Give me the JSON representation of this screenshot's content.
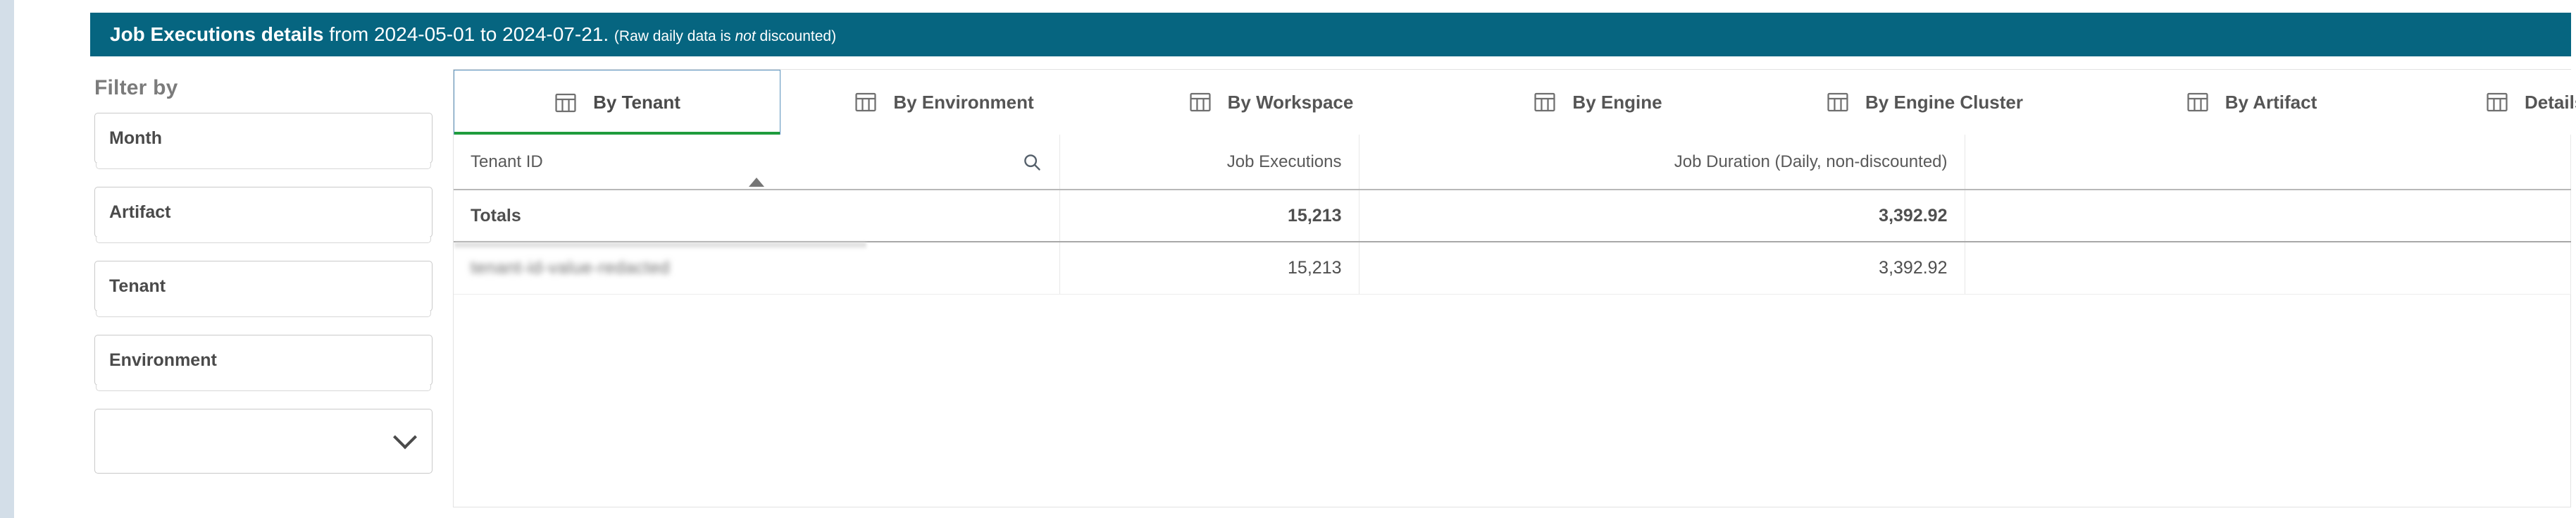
{
  "banner": {
    "title_strong": "Job Executions details",
    "title_range": " from 2024-05-01 to 2024-07-21. ",
    "note_open": "(Raw daily data is ",
    "note_italic": "not",
    "note_close": " discounted)",
    "bg_color": "#066580",
    "text_color": "#ffffff"
  },
  "sidebar": {
    "heading": "Filter by",
    "filters": [
      {
        "label": "Month"
      },
      {
        "label": "Artifact"
      },
      {
        "label": "Tenant"
      },
      {
        "label": "Environment"
      }
    ],
    "dropdown": {
      "value": "",
      "placeholder": "",
      "icon": "chevron-down-icon"
    }
  },
  "tabs": {
    "active_index": 0,
    "active_border_color": "#5b93bd",
    "active_underline_color": "#1f9c3d",
    "items": [
      {
        "label": "By Tenant",
        "icon": "table-icon"
      },
      {
        "label": "By Environment",
        "icon": "table-icon"
      },
      {
        "label": "By Workspace",
        "icon": "table-icon"
      },
      {
        "label": "By Engine",
        "icon": "table-icon"
      },
      {
        "label": "By Engine Cluster",
        "icon": "table-icon"
      },
      {
        "label": "By Artifact",
        "icon": "table-icon"
      },
      {
        "label": "Details by Month",
        "icon": "table-icon"
      }
    ]
  },
  "table": {
    "columns": [
      {
        "label": "Tenant ID",
        "align": "left",
        "sorted": true,
        "searchable": true
      },
      {
        "label": "Job Executions",
        "align": "right",
        "sorted": false,
        "searchable": false
      },
      {
        "label": "Job Duration (Daily, non-discounted)",
        "align": "right",
        "sorted": false,
        "searchable": false
      },
      {
        "label": "",
        "align": "left",
        "sorted": false,
        "searchable": false
      }
    ],
    "totals_row": {
      "label": "Totals",
      "job_executions": "15,213",
      "job_duration": "3,392.92",
      "pad": ""
    },
    "rows": [
      {
        "tenant_id": "tenant-id-value-redacted",
        "tenant_id_redacted": true,
        "job_executions": "15,213",
        "job_duration": "3,392.92",
        "pad": ""
      }
    ]
  }
}
